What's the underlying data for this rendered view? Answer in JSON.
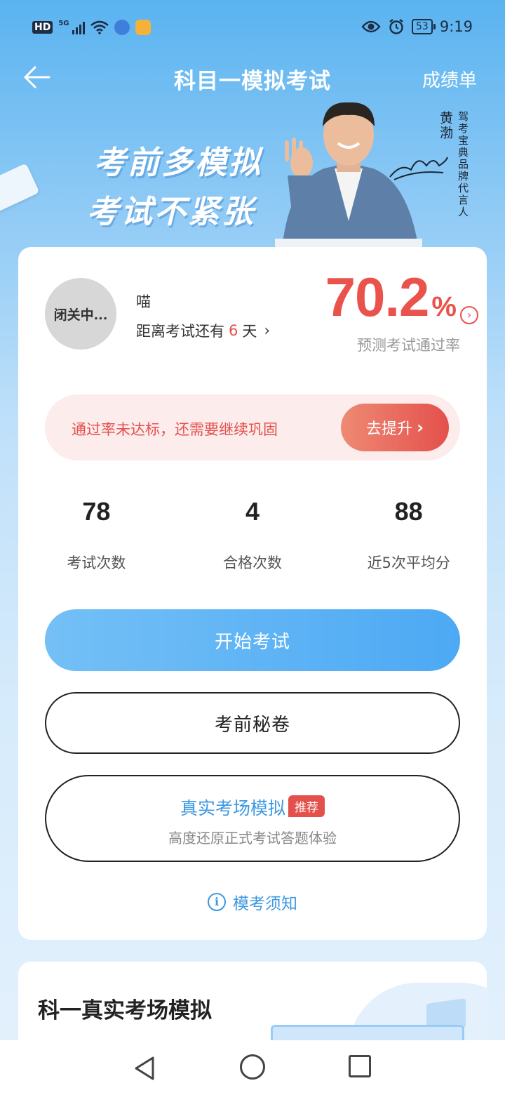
{
  "status_bar": {
    "hd": "HD",
    "network": "5G",
    "battery": "53",
    "time": "9:19"
  },
  "nav": {
    "title": "科目一模拟考试",
    "right": "成绩单"
  },
  "banner": {
    "line1": "考前多模拟",
    "line2": "考试不紧张",
    "endorser_name": "黄渤",
    "endorser_role": "驾考宝典品牌代言人"
  },
  "profile": {
    "avatar_text": "闭关中...",
    "username": "喵",
    "countdown_prefix": "距离考试还有",
    "countdown_days": "6",
    "countdown_suffix": "天"
  },
  "pass_rate": {
    "value": "70.2",
    "unit": "%",
    "label": "预测考试通过率"
  },
  "alert": {
    "text": "通过率未达标，还需要继续巩固",
    "button": "去提升"
  },
  "stats": [
    {
      "value": "78",
      "label": "考试次数"
    },
    {
      "value": "4",
      "label": "合格次数"
    },
    {
      "value": "88",
      "label": "近5次平均分"
    }
  ],
  "buttons": {
    "start": "开始考试",
    "secret": "考前秘卷",
    "real_title": "真实考场模拟",
    "real_tag": "推荐",
    "real_sub": "高度还原正式考试答题体验"
  },
  "notice": "模考须知",
  "section2": {
    "title": "科一真实考场模拟"
  },
  "colors": {
    "accent_blue": "#4da9f4",
    "accent_red": "#e4504c"
  }
}
